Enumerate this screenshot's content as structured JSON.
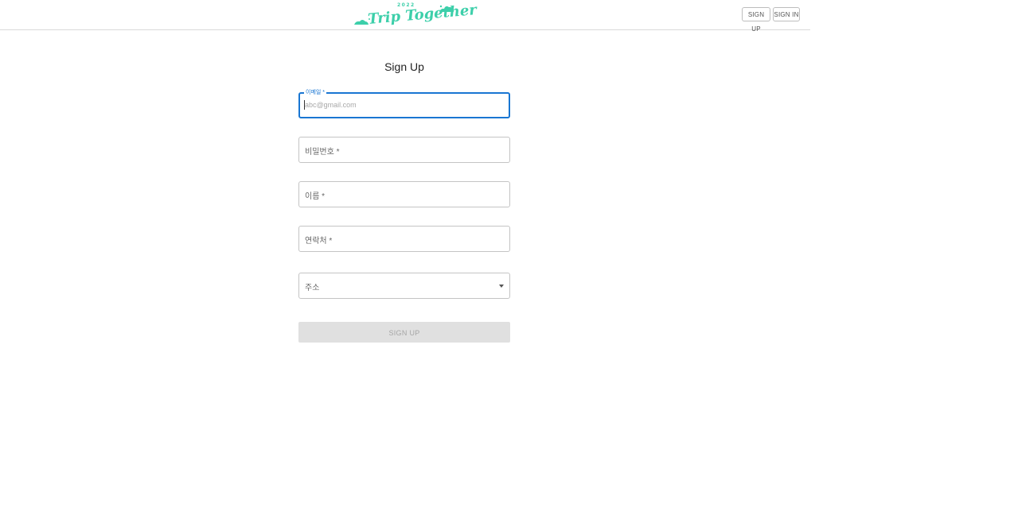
{
  "header": {
    "logo": {
      "year": "2022",
      "text": "Trip Together",
      "color": "#3dcfaa"
    },
    "nav": {
      "signup_label": "SIGN UP",
      "signin_label": "SIGN IN"
    }
  },
  "form": {
    "title": "Sign Up",
    "email": {
      "label": "이메일 *",
      "placeholder": "abc@gmail.com"
    },
    "password": {
      "label": "비밀번호 *"
    },
    "name": {
      "label": "이름 *"
    },
    "phone": {
      "label": "연락처 *"
    },
    "address": {
      "label": "주소",
      "icon": "caret-down-icon"
    },
    "submit_label": "SIGN UP"
  },
  "colors": {
    "accent": "#1976d2",
    "brand": "#3dcfaa",
    "disabled_bg": "#e0e0e0",
    "disabled_text": "#a6a6a6"
  }
}
